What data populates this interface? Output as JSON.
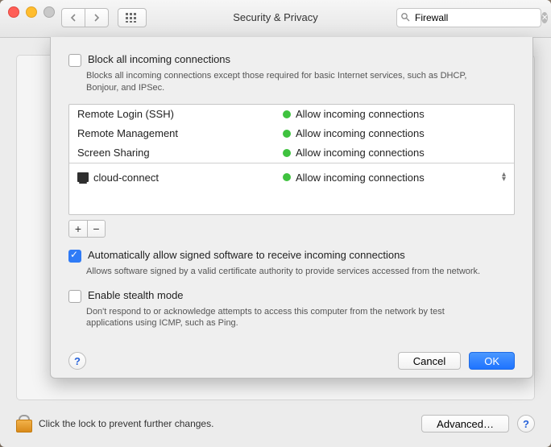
{
  "window": {
    "title": "Security & Privacy"
  },
  "search": {
    "value": "Firewall"
  },
  "sheet": {
    "block": {
      "checked": false,
      "label": "Block all incoming connections",
      "desc": "Blocks all incoming connections except those required for basic Internet services,  such as DHCP, Bonjour, and IPSec."
    },
    "services": [
      {
        "name": "Remote Login (SSH)",
        "status": "Allow incoming connections"
      },
      {
        "name": "Remote Management",
        "status": "Allow incoming connections"
      },
      {
        "name": "Screen Sharing",
        "status": "Allow incoming connections"
      }
    ],
    "apps": [
      {
        "name": "cloud-connect",
        "status": "Allow incoming connections"
      }
    ],
    "add_label": "+",
    "remove_label": "−",
    "auto_allow": {
      "checked": true,
      "label": "Automatically allow signed software to receive incoming connections",
      "desc": "Allows software signed by a valid certificate authority to provide services accessed from the network."
    },
    "stealth": {
      "checked": false,
      "label": "Enable stealth mode",
      "desc": "Don't respond to or acknowledge attempts to access this computer from the network by test applications using ICMP, such as Ping."
    },
    "help": "?",
    "cancel": "Cancel",
    "ok": "OK"
  },
  "footer": {
    "lock_text": "Click the lock to prevent further changes.",
    "advanced": "Advanced…",
    "help": "?"
  }
}
